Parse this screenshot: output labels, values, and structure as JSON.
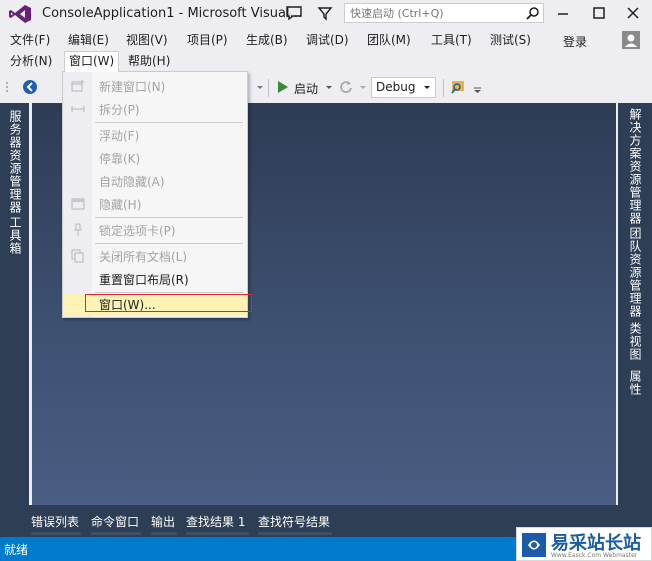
{
  "title_bar": {
    "app_title": "ConsoleApplication1 - Microsoft Visual...",
    "quick_launch_placeholder": "快速启动 (Ctrl+Q)",
    "icons": [
      "visual-studio-logo",
      "feedback-icon",
      "filter-icon",
      "search-icon",
      "minimize-icon",
      "maximize-icon",
      "close-icon"
    ]
  },
  "menu_bar": {
    "items": [
      "文件(F)",
      "编辑(E)",
      "视图(V)",
      "项目(P)",
      "生成(B)",
      "调试(D)",
      "团队(M)",
      "工具(T)",
      "测试(S)"
    ],
    "second_row": [
      "分析(N)",
      "窗口(W)",
      "帮助(H)"
    ],
    "active_item": "窗口(W)",
    "login": "登录"
  },
  "toolbar": {
    "start_label": "启动",
    "configuration": "Debug"
  },
  "window_menu": {
    "items": [
      {
        "label": "新建窗口(N)",
        "enabled": false,
        "icon": "new-window-icon"
      },
      {
        "label": "拆分(P)",
        "enabled": false,
        "icon": "split-icon"
      },
      {
        "label": "浮动(F)",
        "enabled": false
      },
      {
        "label": "停靠(K)",
        "enabled": false
      },
      {
        "label": "自动隐藏(A)",
        "enabled": false
      },
      {
        "label": "隐藏(H)",
        "enabled": false,
        "icon": "hide-window-icon"
      },
      {
        "label": "锁定选项卡(P)",
        "enabled": false,
        "icon": "pin-icon"
      },
      {
        "label": "关闭所有文档(L)",
        "enabled": false,
        "icon": "close-all-documents-icon"
      },
      {
        "label": "重置窗口布局(R)",
        "enabled": true
      },
      {
        "label": "窗口(W)...",
        "enabled": true,
        "highlighted": true
      }
    ]
  },
  "left_dock": {
    "tabs": [
      "服务器资源管理器",
      "工具箱"
    ]
  },
  "right_dock": {
    "tabs": [
      "解决方案资源管理器",
      "团队资源管理器",
      "类视图",
      "属性"
    ]
  },
  "bottom_tabs": [
    "错误列表",
    "命令窗口",
    "输出",
    "查找结果 1",
    "查找符号结果"
  ],
  "status_bar": {
    "text": "就绪"
  },
  "watermark": {
    "text": "易采站长站",
    "subtext": "Www.Easck.Com Webmaster"
  },
  "colors": {
    "accent": "#007acc",
    "workspace": "#2d3e55",
    "highlight": "#fff2b5",
    "highlight_border": "#e0242f"
  }
}
